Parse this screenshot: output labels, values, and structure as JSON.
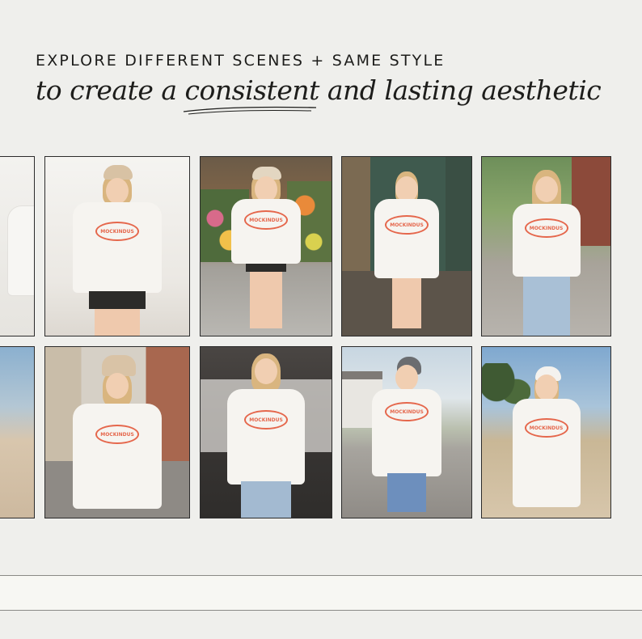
{
  "header": {
    "kicker": "EXPLORE DIFFERENT SCENES + SAME STYLE",
    "line_prefix": "to create a ",
    "line_emphasis": "consistent",
    "line_suffix": " and lasting aesthetic"
  },
  "logo_text": "MOCKINDUS",
  "colors": {
    "background": "#efefec",
    "logo": "#e5674c",
    "text": "#1d1d1b"
  },
  "photos_row1": [
    "studio-partial",
    "studio-cap",
    "flower-shop",
    "porch-door",
    "sidewalk-trees"
  ],
  "photos_row2": [
    "beach-partial",
    "city-street",
    "garage-wall",
    "suburban-road",
    "beach-palms"
  ]
}
